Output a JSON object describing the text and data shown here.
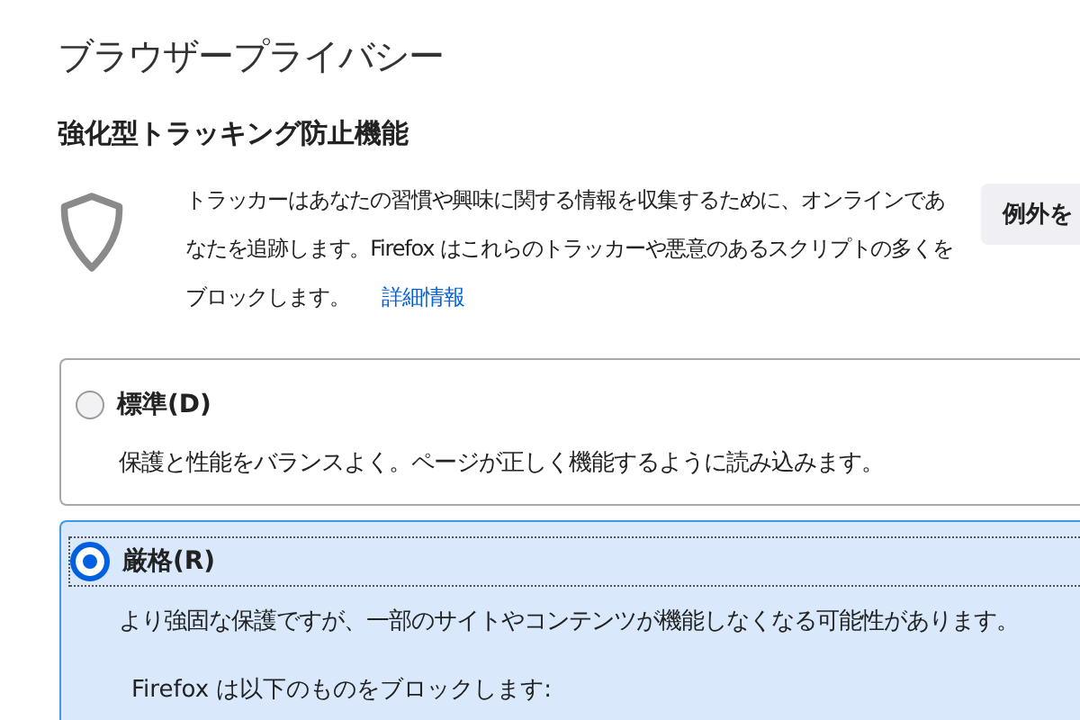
{
  "page_title": "ブラウザープライバシー",
  "section": {
    "heading": "強化型トラッキング防止機能",
    "description": "トラッカーはあなたの習慣や興味に関する情報を収集するために、オンラインであなたを追跡します。Firefox はこれらのトラッカーや悪意のあるスクリプトの多くをブロックします。",
    "link": "詳細情報",
    "exceptions_button": "例外を"
  },
  "options": [
    {
      "label": "標準(D)",
      "description": "保護と性能をバランスよく。ページが正しく機能するように読み込みます。",
      "selected": false,
      "focused": false
    },
    {
      "label": "厳格(R)",
      "description": "より強固な保護ですが、一部のサイトやコンテンツが機能しなくなる可能性があります。",
      "selected": true,
      "focused": true,
      "detail": "Firefox は以下のものをブロックします:"
    }
  ]
}
